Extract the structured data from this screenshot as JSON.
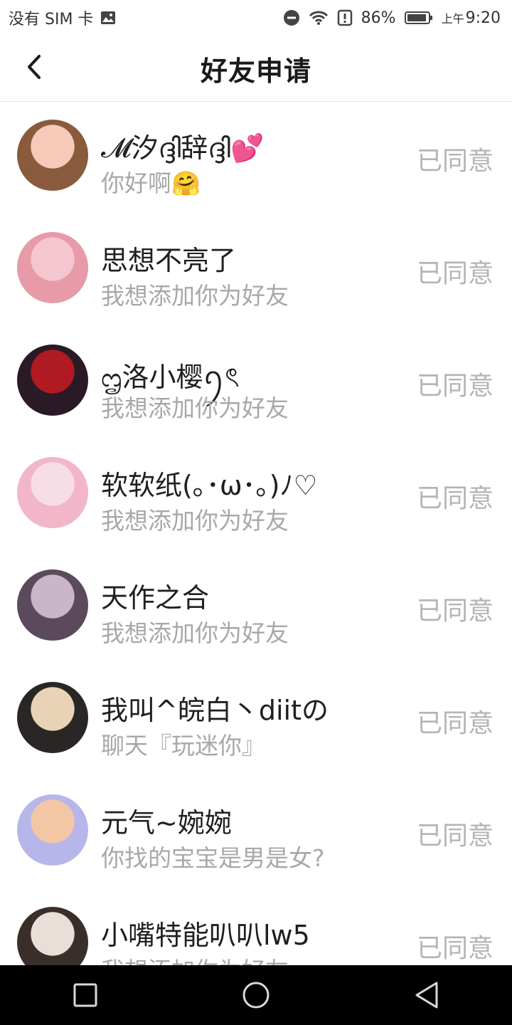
{
  "status_bar": {
    "carrier": "没有 SIM 卡",
    "battery": "86%",
    "time_prefix": "上午",
    "time": "9:20"
  },
  "header": {
    "title": "好友申请"
  },
  "requests": [
    {
      "name": "𝓜汐ദ്ദി辞ദ്ദി💕",
      "message": "你好啊🤗",
      "status": "已同意",
      "avatar_colors": [
        "#f6c9b9",
        "#8a5a3c"
      ]
    },
    {
      "name": "思想不亮了",
      "message": "我想添加你为好友",
      "status": "已同意",
      "avatar_colors": [
        "#f4c6cf",
        "#e79aa8"
      ]
    },
    {
      "name": "ᦗ洛小樱ꪆৎ",
      "message": "我想添加你为好友",
      "status": "已同意",
      "avatar_colors": [
        "#b01a22",
        "#2a1a25"
      ]
    },
    {
      "name": "软软纸(｡･ω･｡)ﾉ♡",
      "message": "我想添加你为好友",
      "status": "已同意",
      "avatar_colors": [
        "#f7dde6",
        "#f2b6c8"
      ]
    },
    {
      "name": "天作之合",
      "message": "我想添加你为好友",
      "status": "已同意",
      "avatar_colors": [
        "#c9b6c7",
        "#5a4a5c"
      ]
    },
    {
      "name": "我叫^皖白丶diitの",
      "message": "聊天『玩迷你』",
      "status": "已同意",
      "avatar_colors": [
        "#e9d2b6",
        "#2b2626"
      ]
    },
    {
      "name": "元气~婉婉",
      "message": "你找的宝宝是男是女?",
      "status": "已同意",
      "avatar_colors": [
        "#f3c7a6",
        "#b7b6ea"
      ]
    },
    {
      "name": "小嘴特能叭叭lw5",
      "message": "我想添加你为好友",
      "status": "已同意",
      "avatar_colors": [
        "#e8e0d8",
        "#3a2e2a"
      ]
    }
  ]
}
